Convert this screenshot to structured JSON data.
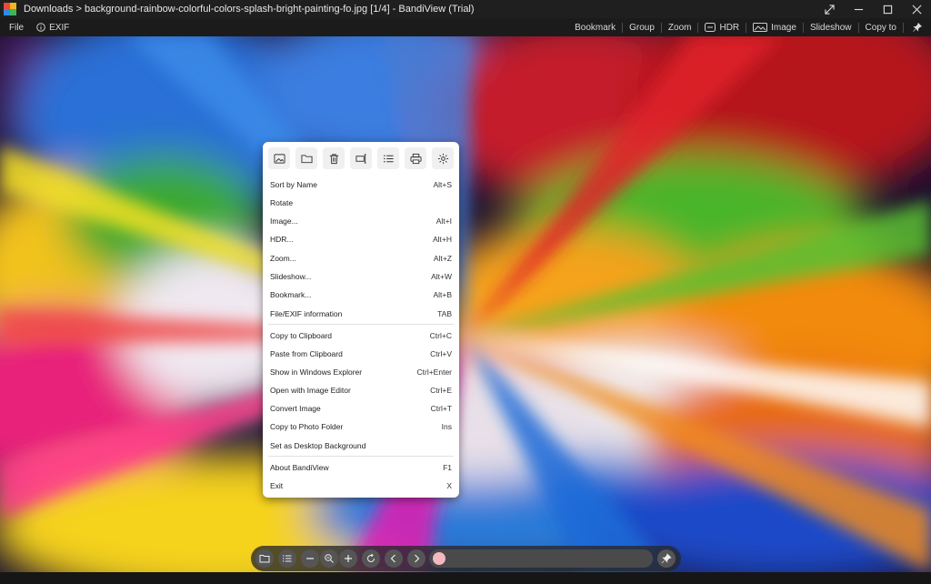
{
  "window": {
    "title": "Downloads > background-rainbow-colorful-colors-splash-bright-painting-fo.jpg [1/4] - BandiView (Trial)"
  },
  "menubar": {
    "file": "File",
    "exif": "EXIF",
    "bookmark": "Bookmark",
    "group": "Group",
    "zoom": "Zoom",
    "hdr": "HDR",
    "image": "Image",
    "slideshow": "Slideshow",
    "copy_to": "Copy to"
  },
  "context_menu": {
    "icon_buttons": [
      "image-icon",
      "folder-icon",
      "trash-icon",
      "rename-icon",
      "list-icon",
      "print-icon",
      "gear-icon"
    ],
    "items": [
      {
        "label": "Sort by Name",
        "shortcut": "Alt+S"
      },
      {
        "label": "Rotate",
        "shortcut": ""
      },
      {
        "label": "Image...",
        "shortcut": "Alt+I"
      },
      {
        "label": "HDR...",
        "shortcut": "Alt+H"
      },
      {
        "label": "Zoom...",
        "shortcut": "Alt+Z"
      },
      {
        "label": "Slideshow...",
        "shortcut": "Alt+W"
      },
      {
        "label": "Bookmark...",
        "shortcut": "Alt+B"
      },
      {
        "label": "File/EXIF information",
        "shortcut": "TAB"
      },
      {
        "label": "Copy to Clipboard",
        "shortcut": "Ctrl+C"
      },
      {
        "label": "Paste from Clipboard",
        "shortcut": "Ctrl+V"
      },
      {
        "label": "Show in Windows Explorer",
        "shortcut": "Ctrl+Enter"
      },
      {
        "label": "Open with Image Editor",
        "shortcut": "Ctrl+E"
      },
      {
        "label": "Convert Image",
        "shortcut": "Ctrl+T"
      },
      {
        "label": "Copy to Photo Folder",
        "shortcut": "Ins"
      },
      {
        "label": "Set as Desktop Background",
        "shortcut": ""
      },
      {
        "label": "About BandiView",
        "shortcut": "F1"
      },
      {
        "label": "Exit",
        "shortcut": "X"
      }
    ]
  },
  "bottom_toolbar": {
    "icons": [
      "folder-icon",
      "list-icon",
      "minus-icon",
      "zoom-icon",
      "plus-icon",
      "rotate-icon",
      "prev-icon",
      "next-icon",
      "pin-icon"
    ],
    "position": 0
  },
  "colors": {
    "titlebar": "#1f1f1f",
    "menubar": "#1b1b1b",
    "slider_knob": "#f4b8c0"
  }
}
